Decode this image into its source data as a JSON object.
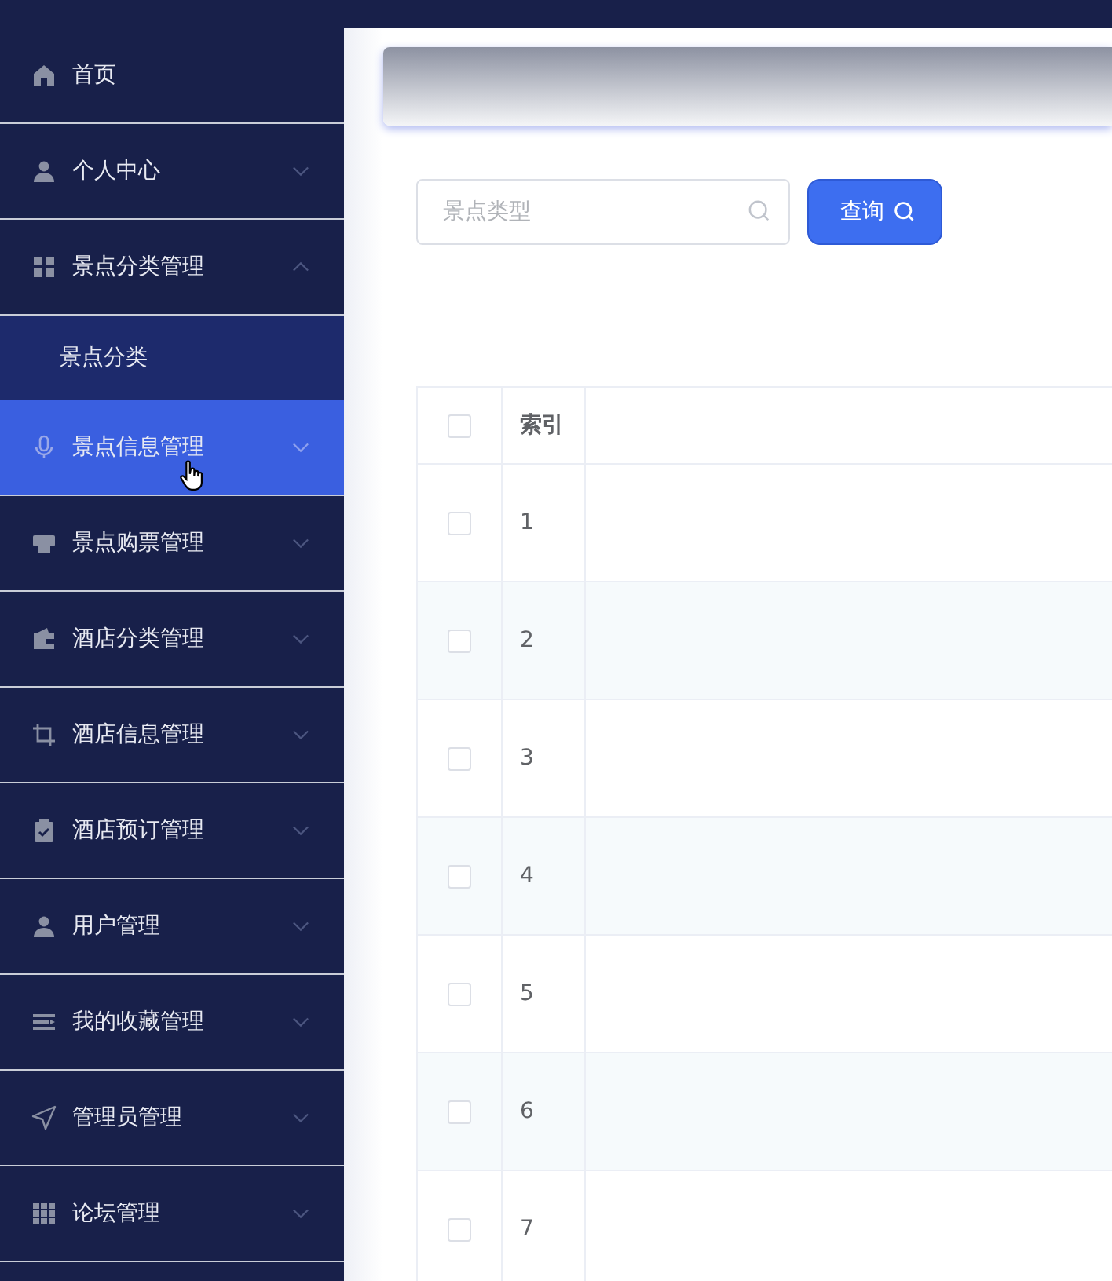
{
  "sidebar": {
    "items": [
      {
        "label": "首页",
        "kind": "link",
        "selected": false
      },
      {
        "label": "个人中心",
        "kind": "menu",
        "expanded": false,
        "selected": false
      },
      {
        "label": "景点分类管理",
        "kind": "menu",
        "expanded": true,
        "selected": false,
        "children": [
          {
            "label": "景点分类",
            "selected": false
          }
        ]
      },
      {
        "label": "景点信息管理",
        "kind": "menu",
        "expanded": false,
        "selected": true
      },
      {
        "label": "景点购票管理",
        "kind": "menu",
        "expanded": false,
        "selected": false
      },
      {
        "label": "酒店分类管理",
        "kind": "menu",
        "expanded": false,
        "selected": false
      },
      {
        "label": "酒店信息管理",
        "kind": "menu",
        "expanded": false,
        "selected": false
      },
      {
        "label": "酒店预订管理",
        "kind": "menu",
        "expanded": false,
        "selected": false
      },
      {
        "label": "用户管理",
        "kind": "menu",
        "expanded": false,
        "selected": false
      },
      {
        "label": "我的收藏管理",
        "kind": "menu",
        "expanded": false,
        "selected": false
      },
      {
        "label": "管理员管理",
        "kind": "menu",
        "expanded": false,
        "selected": false
      },
      {
        "label": "论坛管理",
        "kind": "menu",
        "expanded": false,
        "selected": false
      }
    ]
  },
  "search": {
    "placeholder": "景点类型",
    "button": "查询"
  },
  "table": {
    "columns": [
      "索引"
    ],
    "header_checked": false,
    "rows": [
      {
        "index": "1",
        "checked": false
      },
      {
        "index": "2",
        "checked": false
      },
      {
        "index": "3",
        "checked": false
      },
      {
        "index": "4",
        "checked": false
      },
      {
        "index": "5",
        "checked": false
      },
      {
        "index": "6",
        "checked": false
      },
      {
        "index": "7",
        "checked": false
      }
    ]
  }
}
